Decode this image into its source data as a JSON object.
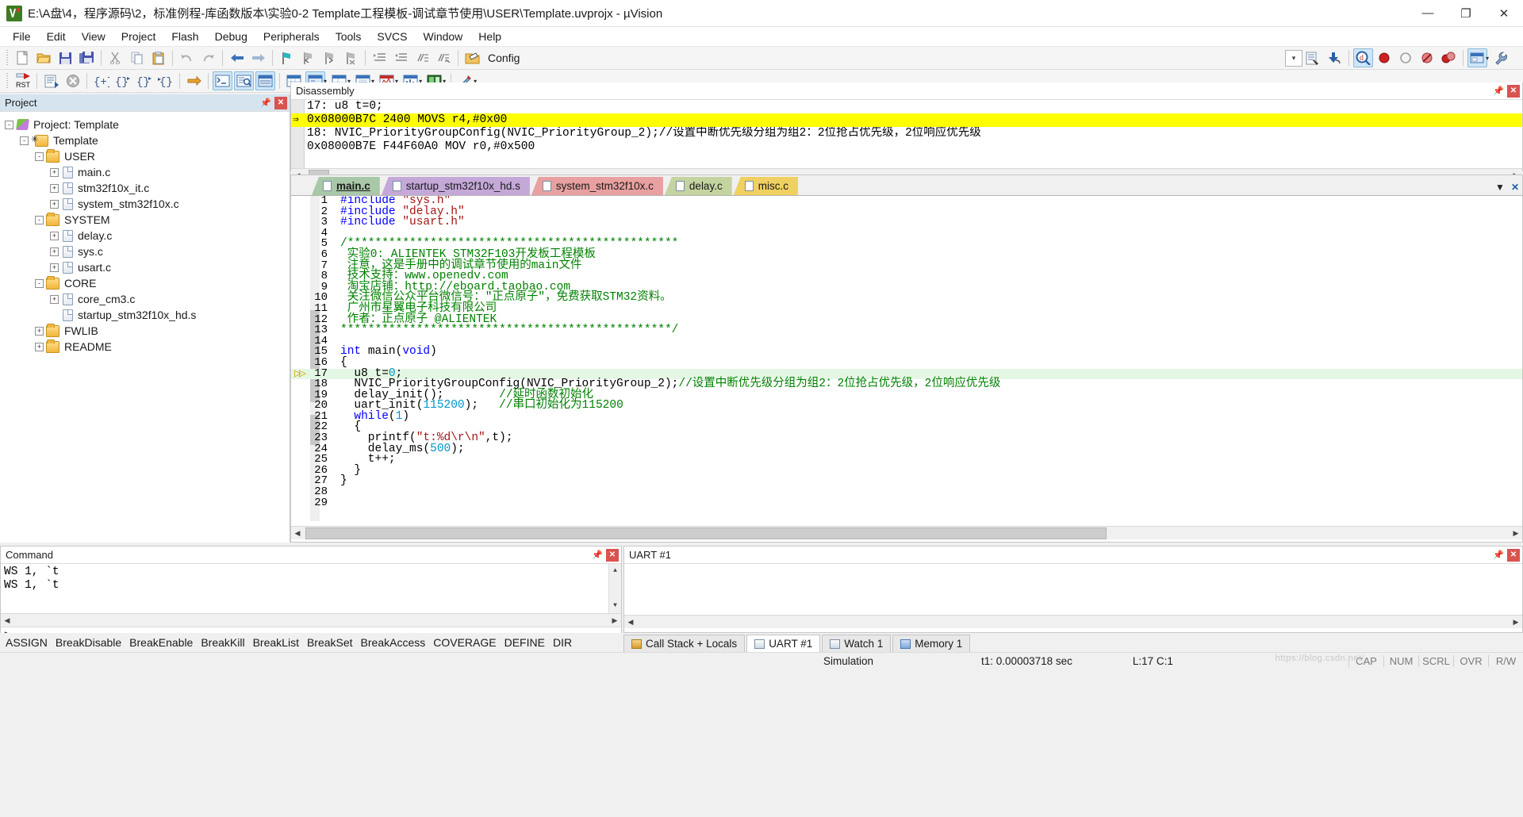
{
  "window": {
    "title": "E:\\A盘\\4，程序源码\\2，标准例程-库函数版本\\实验0-2 Template工程模板-调试章节使用\\USER\\Template.uvprojx - µVision",
    "app_icon": "uvision-icon",
    "minimize": "—",
    "maximize": "❐",
    "close": "✕"
  },
  "menu": {
    "items": [
      "File",
      "Edit",
      "View",
      "Project",
      "Flash",
      "Debug",
      "Peripherals",
      "Tools",
      "SVCS",
      "Window",
      "Help"
    ]
  },
  "toolbar1": {
    "config_label": "Config",
    "buttons": [
      "new-file-icon",
      "open-file-icon",
      "save-icon",
      "save-all-icon",
      "cut-icon",
      "copy-icon",
      "paste-icon",
      "undo-icon",
      "redo-icon",
      "navigate-back-icon",
      "navigate-forward-icon",
      "bookmark-toggle-icon",
      "bookmark-prev-icon",
      "bookmark-next-icon",
      "bookmark-clear-icon",
      "indent-icon",
      "outdent-icon",
      "comment-icon",
      "uncomment-icon",
      "config-wizard-icon",
      "combo-dropdown",
      "build-output-icon",
      "download-icon",
      "debug-session-icon",
      "insert-breakpoint-icon",
      "kill-breakpoint-icon",
      "disable-breakpoint-icon",
      "disable-all-breakpoints-icon",
      "target-options-icon"
    ]
  },
  "toolbar2": {
    "buttons": [
      "reset-cpu-icon",
      "run-icon",
      "stop-icon",
      "step-icon",
      "step-over-icon",
      "step-out-icon",
      "run-to-cursor-icon",
      "show-next-statement-icon",
      "command-window-icon",
      "disassembly-window-icon",
      "symbols-window-icon",
      "registers-window-icon",
      "call-stack-icon",
      "watch-window-icon",
      "memory-window-icon",
      "serial-window-icon",
      "analysis-window-icon",
      "trace-icon",
      "system-viewer-icon",
      "toolbox-icon"
    ]
  },
  "project_panel": {
    "title": "Project",
    "pin_icon": "pin-icon",
    "close_icon": "close-icon",
    "tree": [
      {
        "label": "Project: Template",
        "indent": 0,
        "expander": "-",
        "icon": "project-icon"
      },
      {
        "label": "Template",
        "indent": 1,
        "expander": "-",
        "icon": "target-icon"
      },
      {
        "label": "USER",
        "indent": 2,
        "expander": "-",
        "icon": "folder-icon"
      },
      {
        "label": "main.c",
        "indent": 3,
        "expander": "+",
        "icon": "c-file-icon"
      },
      {
        "label": "stm32f10x_it.c",
        "indent": 3,
        "expander": "+",
        "icon": "c-file-icon"
      },
      {
        "label": "system_stm32f10x.c",
        "indent": 3,
        "expander": "+",
        "icon": "c-file-icon"
      },
      {
        "label": "SYSTEM",
        "indent": 2,
        "expander": "-",
        "icon": "folder-icon"
      },
      {
        "label": "delay.c",
        "indent": 3,
        "expander": "+",
        "icon": "c-file-icon"
      },
      {
        "label": "sys.c",
        "indent": 3,
        "expander": "+",
        "icon": "c-file-icon"
      },
      {
        "label": "usart.c",
        "indent": 3,
        "expander": "+",
        "icon": "c-file-icon"
      },
      {
        "label": "CORE",
        "indent": 2,
        "expander": "-",
        "icon": "folder-icon"
      },
      {
        "label": "core_cm3.c",
        "indent": 3,
        "expander": "+",
        "icon": "c-file-icon"
      },
      {
        "label": "startup_stm32f10x_hd.s",
        "indent": 3,
        "expander": "",
        "icon": "asm-file-icon"
      },
      {
        "label": "FWLIB",
        "indent": 2,
        "expander": "+",
        "icon": "folder-icon"
      },
      {
        "label": "README",
        "indent": 2,
        "expander": "+",
        "icon": "folder-icon"
      }
    ]
  },
  "disassembly": {
    "title": "Disassembly",
    "pin_icon": "pin-icon",
    "close_icon": "close-icon",
    "lines": [
      {
        "kind": "source",
        "num": "17:",
        "text": "u8 t=0;",
        "highlight": false,
        "pc": false
      },
      {
        "kind": "asm",
        "address": "0x08000B7C",
        "opcode": "2400",
        "mnemonic": "MOVS",
        "operands": "r4,#0x00",
        "highlight": true,
        "pc": true
      },
      {
        "kind": "source",
        "num": "18:",
        "text": "NVIC_PriorityGroupConfig(NVIC_PriorityGroup_2);//设置中断优先级分组为组2：2位抢占优先级，2位响应优先级",
        "highlight": false,
        "pc": false
      },
      {
        "kind": "asm",
        "address": "0x08000B7E",
        "opcode": "F44F60A0",
        "mnemonic": "MOV",
        "operands": "r0,#0x500",
        "highlight": false,
        "pc": false
      }
    ]
  },
  "editor": {
    "tabs": [
      {
        "label": "main.c",
        "color": "#a8c8a8",
        "active": true
      },
      {
        "label": "startup_stm32f10x_hd.s",
        "color": "#c4a8d8",
        "active": false
      },
      {
        "label": "system_stm32f10x.c",
        "color": "#e8a0a0",
        "active": false
      },
      {
        "label": "delay.c",
        "color": "#c4d4a0",
        "active": false
      },
      {
        "label": "misc.c",
        "color": "#f0d060",
        "active": false
      }
    ],
    "tab_controls": {
      "dropdown": "▼",
      "close": "✕"
    },
    "current_line": 17,
    "code": [
      {
        "n": 1,
        "segments": [
          {
            "t": "#include ",
            "c": "pp"
          },
          {
            "t": "\"sys.h\"",
            "c": "str"
          }
        ]
      },
      {
        "n": 2,
        "segments": [
          {
            "t": "#include ",
            "c": "pp"
          },
          {
            "t": "\"delay.h\"",
            "c": "str"
          }
        ]
      },
      {
        "n": 3,
        "segments": [
          {
            "t": "#include ",
            "c": "pp"
          },
          {
            "t": "\"usart.h\"",
            "c": "str"
          }
        ]
      },
      {
        "n": 4,
        "segments": []
      },
      {
        "n": 5,
        "segments": [
          {
            "t": "/************************************************",
            "c": "cm"
          }
        ]
      },
      {
        "n": 6,
        "segments": [
          {
            "t": " 实验0: ALIENTEK STM32F103开发板工程模板",
            "c": "cm"
          }
        ]
      },
      {
        "n": 7,
        "segments": [
          {
            "t": " 注意，这是手册中的调试章节使用的main文件",
            "c": "cm"
          }
        ]
      },
      {
        "n": 8,
        "segments": [
          {
            "t": " 技术支持：www.openedv.com",
            "c": "cm"
          }
        ]
      },
      {
        "n": 9,
        "segments": [
          {
            "t": " 淘宝店铺：http://eboard.taobao.com",
            "c": "cm"
          }
        ]
      },
      {
        "n": 10,
        "segments": [
          {
            "t": " 关注微信公众平台微信号：\"正点原子\"，免费获取STM32资料。",
            "c": "cm"
          }
        ]
      },
      {
        "n": 11,
        "segments": [
          {
            "t": " 广州市星翼电子科技有限公司",
            "c": "cm"
          }
        ]
      },
      {
        "n": 12,
        "segments": [
          {
            "t": " 作者：正点原子 @ALIENTEK",
            "c": "cm"
          }
        ]
      },
      {
        "n": 13,
        "segments": [
          {
            "t": "************************************************/",
            "c": "cm"
          }
        ]
      },
      {
        "n": 14,
        "segments": []
      },
      {
        "n": 15,
        "segments": [
          {
            "t": "int ",
            "c": "kw"
          },
          {
            "t": "main(",
            "c": "pl"
          },
          {
            "t": "void",
            "c": "kw"
          },
          {
            "t": ")",
            "c": "pl"
          }
        ]
      },
      {
        "n": 16,
        "segments": [
          {
            "t": "{",
            "c": "pl"
          }
        ]
      },
      {
        "n": 17,
        "segments": [
          {
            "t": "  u8 t=",
            "c": "pl"
          },
          {
            "t": "0",
            "c": "num"
          },
          {
            "t": ";",
            "c": "pl"
          }
        ],
        "highlight": true,
        "marker": true
      },
      {
        "n": 18,
        "segments": [
          {
            "t": "  NVIC_PriorityGroupConfig(NVIC_PriorityGroup_2);",
            "c": "pl"
          },
          {
            "t": "//设置中断优先级分组为组2：2位抢占优先级，2位响应优先级",
            "c": "cm"
          }
        ]
      },
      {
        "n": 19,
        "segments": [
          {
            "t": "  delay_init();        ",
            "c": "pl"
          },
          {
            "t": "//延时函数初始化",
            "c": "cm"
          }
        ]
      },
      {
        "n": 20,
        "segments": [
          {
            "t": "  uart_init(",
            "c": "pl"
          },
          {
            "t": "115200",
            "c": "num"
          },
          {
            "t": ");   ",
            "c": "pl"
          },
          {
            "t": "//串口初始化为115200",
            "c": "cm"
          }
        ]
      },
      {
        "n": 21,
        "segments": [
          {
            "t": "  while",
            "c": "kw"
          },
          {
            "t": "(",
            "c": "pl"
          },
          {
            "t": "1",
            "c": "num"
          },
          {
            "t": ")",
            "c": "pl"
          }
        ]
      },
      {
        "n": 22,
        "segments": [
          {
            "t": "  {",
            "c": "pl"
          }
        ]
      },
      {
        "n": 23,
        "segments": [
          {
            "t": "    printf(",
            "c": "pl"
          },
          {
            "t": "\"t:%d\\r\\n\"",
            "c": "str"
          },
          {
            "t": ",t);",
            "c": "pl"
          }
        ]
      },
      {
        "n": 24,
        "segments": [
          {
            "t": "    delay_ms(",
            "c": "pl"
          },
          {
            "t": "500",
            "c": "num"
          },
          {
            "t": ");",
            "c": "pl"
          }
        ]
      },
      {
        "n": 25,
        "segments": [
          {
            "t": "    t++;",
            "c": "pl"
          }
        ]
      },
      {
        "n": 26,
        "segments": [
          {
            "t": "  }",
            "c": "pl"
          }
        ]
      },
      {
        "n": 27,
        "segments": [
          {
            "t": "}",
            "c": "pl"
          }
        ]
      },
      {
        "n": 28,
        "segments": []
      },
      {
        "n": 29,
        "segments": []
      }
    ]
  },
  "command_panel": {
    "title": "Command",
    "pin_icon": "pin-icon",
    "close_icon": "close-icon",
    "output": [
      "WS 1, `t",
      "WS 1, `t"
    ],
    "prompt": ">",
    "input_value": ""
  },
  "uart_panel": {
    "title": "UART #1",
    "pin_icon": "pin-icon",
    "close_icon": "close-icon",
    "content": ""
  },
  "command_buttons": {
    "items": [
      "ASSIGN",
      "BreakDisable",
      "BreakEnable",
      "BreakKill",
      "BreakList",
      "BreakSet",
      "BreakAccess",
      "COVERAGE",
      "DEFINE",
      "DIR"
    ]
  },
  "bottom_tabs": {
    "items": [
      {
        "label": "Call Stack + Locals",
        "icon": "call-stack-icon",
        "active": false
      },
      {
        "label": "UART #1",
        "icon": "uart-icon",
        "active": true
      },
      {
        "label": "Watch 1",
        "icon": "watch-icon",
        "active": false
      },
      {
        "label": "Memory 1",
        "icon": "memory-icon",
        "active": false
      }
    ]
  },
  "statusbar": {
    "mode": "Simulation",
    "time": "t1: 0.00003718 sec",
    "position": "L:17 C:1",
    "indicators": [
      "CAP",
      "NUM",
      "SCRL",
      "OVR",
      "R/W"
    ],
    "watermark": "https://blog.csdn.net/"
  },
  "colors": {
    "highlight_yellow": "#ffff00",
    "current_line_green": "#e4f7e4",
    "accent_blue": "#2a6099",
    "comment_green": "#008000",
    "string_red": "#a31515",
    "keyword_blue": "#0000ff",
    "number_cyan": "#0096c8"
  }
}
